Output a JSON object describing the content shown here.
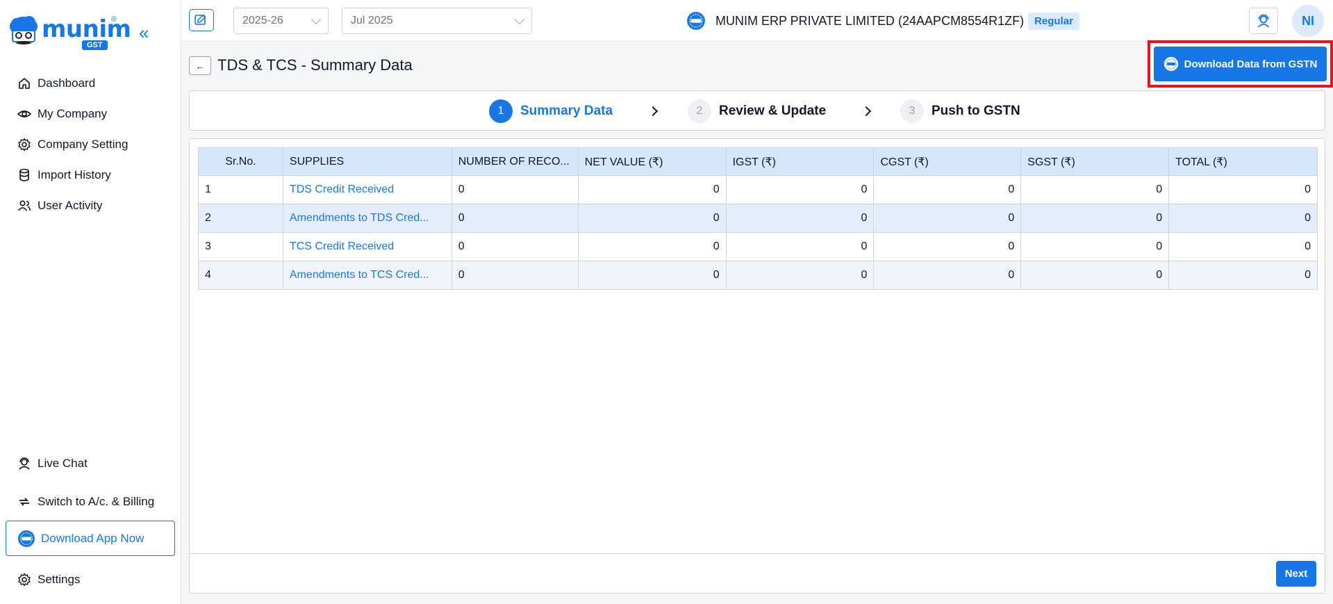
{
  "brand": {
    "name": "munim",
    "reg": "®",
    "tag": "GST"
  },
  "sidebar": {
    "items": [
      {
        "label": "Dashboard",
        "icon": "home-icon"
      },
      {
        "label": "My Company",
        "icon": "eye-icon"
      },
      {
        "label": "Company Setting",
        "icon": "gear-icon"
      },
      {
        "label": "Import History",
        "icon": "database-icon"
      },
      {
        "label": "User Activity",
        "icon": "users-icon"
      }
    ],
    "bottom": {
      "live_chat": "Live Chat",
      "switch": "Switch to A/c. & Billing",
      "download_app": "Download App Now",
      "settings": "Settings"
    }
  },
  "topbar": {
    "year": "2025-26",
    "month": "Jul 2025",
    "company": "MUNIM ERP PRIVATE LIMITED (24AAPCM8554R1ZF)",
    "badge": "Regular",
    "avatar": "NI"
  },
  "page": {
    "back": "←",
    "title": "TDS & TCS - Summary Data",
    "download_btn": "Download Data from GSTN"
  },
  "stepper": [
    {
      "num": "1",
      "label": "Summary Data"
    },
    {
      "num": "2",
      "label": "Review & Update"
    },
    {
      "num": "3",
      "label": "Push to GSTN"
    }
  ],
  "table": {
    "headers": [
      "Sr.No.",
      "SUPPLIES",
      "NUMBER OF RECO...",
      "NET VALUE (₹)",
      "IGST (₹)",
      "CGST (₹)",
      "SGST (₹)",
      "TOTAL (₹)"
    ],
    "rows": [
      [
        "1",
        "TDS Credit Received",
        "0",
        "0",
        "0",
        "0",
        "0",
        "0"
      ],
      [
        "2",
        "Amendments to TDS Cred...",
        "0",
        "0",
        "0",
        "0",
        "0",
        "0"
      ],
      [
        "3",
        "TCS Credit Received",
        "0",
        "0",
        "0",
        "0",
        "0",
        "0"
      ],
      [
        "4",
        "Amendments to TCS Cred...",
        "0",
        "0",
        "0",
        "0",
        "0",
        "0"
      ]
    ]
  },
  "footer": {
    "next": "Next"
  },
  "colors": {
    "accent": "#1877e6",
    "highlight": "#e8141c"
  }
}
